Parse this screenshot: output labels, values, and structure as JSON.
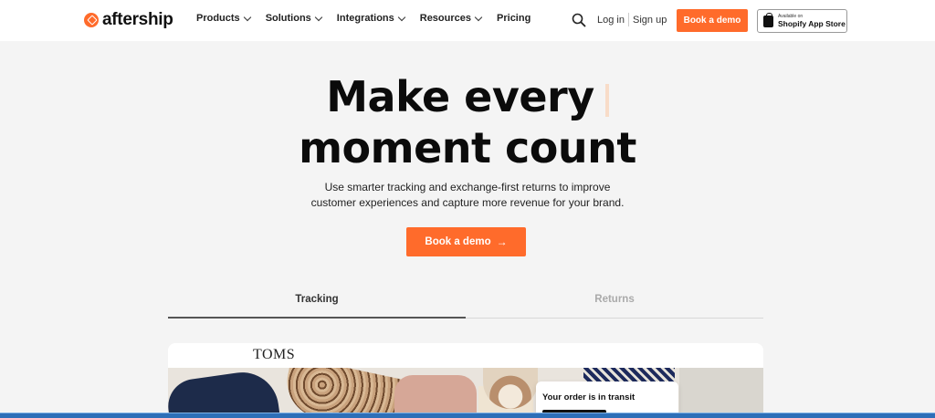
{
  "header": {
    "logo_text": "aftership",
    "nav": [
      {
        "label": "Products",
        "has_dropdown": true
      },
      {
        "label": "Solutions",
        "has_dropdown": true
      },
      {
        "label": "Integrations",
        "has_dropdown": true
      },
      {
        "label": "Resources",
        "has_dropdown": true
      },
      {
        "label": "Pricing",
        "has_dropdown": false
      }
    ],
    "login": "Log in",
    "signup": "Sign up",
    "demo_button": "Book a demo",
    "shopify_small": "Available on",
    "shopify_big": "Shopify App Store"
  },
  "hero": {
    "title_line1": "Make every",
    "title_line2": "moment count",
    "subtitle_line1": "Use smarter tracking and exchange-first returns to improve",
    "subtitle_line2": "customer experiences and capture more revenue for your brand.",
    "cta": "Book a demo",
    "cta_icon": "arrow-right-icon"
  },
  "tabs": [
    {
      "label": "Tracking",
      "active": true
    },
    {
      "label": "Returns",
      "active": false
    }
  ],
  "card": {
    "brand": "TOMS",
    "status": "Your order is in transit"
  },
  "colors": {
    "accent": "#ff6b2b",
    "background": "#f4f4f4",
    "text": "#0b0b0b"
  }
}
